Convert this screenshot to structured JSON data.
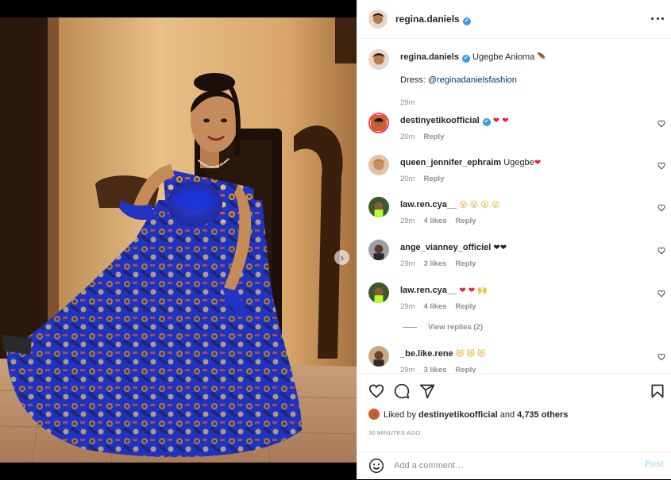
{
  "post": {
    "author": "regina.daniels",
    "verified_badge": "✔",
    "more_icon": "more-horizontal-icon",
    "caption_author": "regina.daniels",
    "caption_text": "Ugegbe Anioma",
    "caption_emoji": "🪶",
    "caption_line2_prefix": "Dress: ",
    "caption_line2_link": "@reginadanielsfashion",
    "caption_time": "29m",
    "next_icon": "chevron-right-icon"
  },
  "comments": [
    {
      "user": "destinyetikoofficial",
      "verified": true,
      "text": "",
      "emoji": "❤ ❤",
      "emoji_color": "red",
      "time": "20m",
      "likes": "",
      "reply": "Reply"
    },
    {
      "user": "queen_jennifer_ephraim",
      "verified": false,
      "text": "Ugegbe",
      "emoji": "❤",
      "emoji_color": "red",
      "time": "20m",
      "likes": "",
      "reply": "Reply"
    },
    {
      "user": "law.ren.cya__",
      "verified": false,
      "text": "",
      "emoji": "😮 😮 😮 😮",
      "emoji_color": "yel",
      "time": "29m",
      "likes": "4 likes",
      "reply": "Reply"
    },
    {
      "user": "ange_vianney_officiel",
      "verified": false,
      "text": "",
      "emoji": "❤❤",
      "emoji_color": "blk",
      "time": "29m",
      "likes": "3 likes",
      "reply": "Reply"
    },
    {
      "user": "law.ren.cya__",
      "verified": false,
      "text": "",
      "emoji": "❤ ❤ 🙌",
      "emoji_color": "red",
      "time": "29m",
      "likes": "4 likes",
      "reply": "Reply"
    },
    {
      "user": "_be.like.rene",
      "verified": false,
      "text": "",
      "emoji": "😻 😻 😻",
      "emoji_color": "yel",
      "time": "29m",
      "likes": "3 likes",
      "reply": "Reply"
    }
  ],
  "view_replies": "View replies (2)",
  "actions": {
    "like_icon": "heart-icon",
    "comment_icon": "comment-icon",
    "share_icon": "share-icon",
    "save_icon": "bookmark-icon",
    "liked_by_prefix": "Liked by ",
    "liked_by_user": "destinyetikoofficial",
    "liked_by_and": " and ",
    "liked_by_count": "4,735 others",
    "time_ago": "30 MINUTES AGO"
  },
  "add_comment": {
    "placeholder": "Add a comment…",
    "post_label": "Post",
    "emoji_icon": "smiley-icon"
  },
  "colors": {
    "link": "#00376b",
    "verified": "#3897f0",
    "post_disabled": "#b2dffc",
    "heart_red": "#ed1c3a"
  }
}
